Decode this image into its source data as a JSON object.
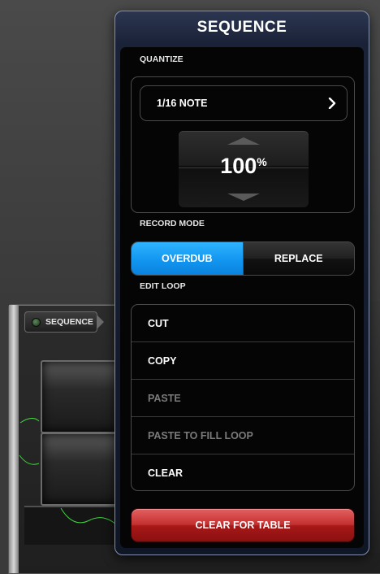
{
  "background": {
    "sequence_button_label": "SEQUENCE"
  },
  "popover": {
    "title": "SEQUENCE",
    "quantize": {
      "label": "QUANTIZE",
      "note_value": "1/16 NOTE",
      "percent_value": "100",
      "percent_unit": "%"
    },
    "record_mode": {
      "label": "RECORD MODE",
      "options": [
        "OVERDUB",
        "REPLACE"
      ],
      "selected": "OVERDUB"
    },
    "edit_loop": {
      "label": "EDIT LOOP",
      "items": [
        {
          "label": "CUT",
          "enabled": true
        },
        {
          "label": "COPY",
          "enabled": true
        },
        {
          "label": "PASTE",
          "enabled": false
        },
        {
          "label": "PASTE TO FILL LOOP",
          "enabled": false
        },
        {
          "label": "CLEAR",
          "enabled": true
        }
      ]
    },
    "clear_for_table_label": "CLEAR FOR TABLE"
  },
  "colors": {
    "accent_blue": "#1a9af2",
    "danger_red": "#c43030",
    "popover_frame": "#1a2238"
  }
}
